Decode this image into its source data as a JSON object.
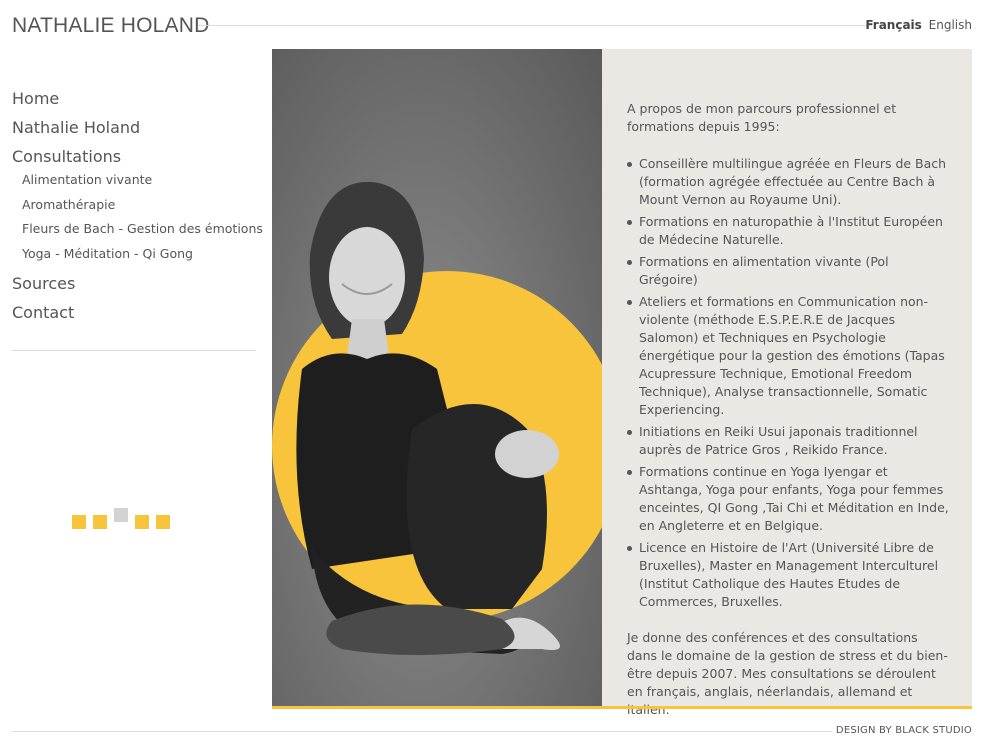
{
  "site": {
    "title": "NATHALIE HOLAND"
  },
  "languages": {
    "active": "Français",
    "other": "English"
  },
  "nav": {
    "items": [
      {
        "label": "Home"
      },
      {
        "label": "Nathalie Holand"
      },
      {
        "label": "Consultations"
      },
      {
        "label": "Sources"
      },
      {
        "label": "Contact"
      }
    ],
    "subitems": [
      {
        "label": "Alimentation vivante"
      },
      {
        "label": "Aromathérapie"
      },
      {
        "label": "Fleurs de Bach - Gestion des émotions"
      },
      {
        "label": "Yoga - Méditation - Qi Gong"
      }
    ]
  },
  "content": {
    "intro": "A propos de mon parcours professionnel et formations depuis 1995:",
    "qualifications": [
      "Conseillère multilingue agréée en Fleurs de Bach (formation agrégée effectuée au Centre Bach à Mount Vernon au Royaume Uni).",
      "Formations en naturopathie à l'Institut Européen de Médecine Naturelle.",
      "Formations en alimentation vivante (Pol Grégoire)",
      "Ateliers et formations en Communication non-violente (méthode E.S.P.E.R.E de Jacques Salomon) et Techniques en Psychologie énergétique pour la gestion des émotions (Tapas Acupressure Technique, Emotional Freedom Technique), Analyse transactionnelle, Somatic Experiencing.",
      "Initiations en Reiki Usui japonais traditionnel auprès de Patrice Gros , Reikido France.",
      "Formations continue en Yoga  Iyengar et Ashtanga, Yoga pour enfants, Yoga pour femmes enceintes, QI Gong ,Tai Chi et Méditation en Inde, en Angleterre et en Belgique.",
      "Licence en Histoire de l'Art (Université Libre de Bruxelles), Master en Management Interculturel (Institut Catholique des Hautes Etudes de Commerces, Bruxelles."
    ],
    "outro": "Je donne des conférences et des consultations dans le domaine de la gestion de stress et du bien-être depuis 2007. Mes consultations se déroulent en français, anglais, néerlandais, allemand et italien."
  },
  "footer": {
    "credit": "DESIGN BY BLACK STUDIO"
  },
  "colors": {
    "accent": "#f7c43b",
    "panel": "#ebe7e2",
    "text": "#555555"
  }
}
